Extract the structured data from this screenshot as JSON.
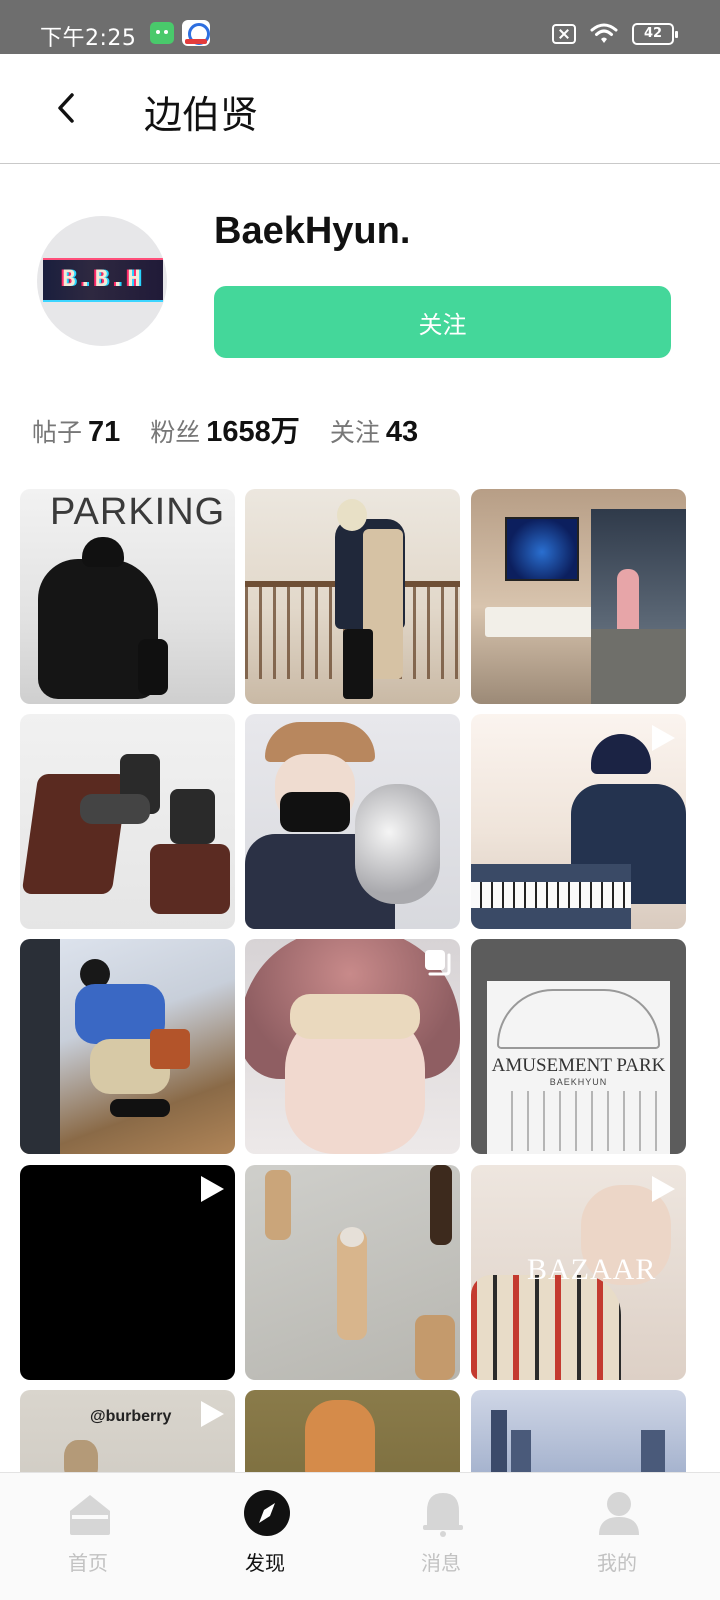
{
  "status_bar": {
    "time": "下午2:25",
    "battery": "42",
    "icons": [
      "android-notification-icon",
      "app-notification-icon",
      "no-sim-icon",
      "wifi-icon",
      "battery-icon"
    ]
  },
  "header": {
    "title": "边伯贤",
    "back_icon": "back-chevron-icon"
  },
  "profile": {
    "avatar_text": "B.B.H",
    "username": "BaekHyun.",
    "follow_label": "关注",
    "accent_color": "#44d79a"
  },
  "stats": [
    {
      "label": "帖子",
      "value": "71"
    },
    {
      "label": "粉丝",
      "value": "1658万"
    },
    {
      "label": "关注",
      "value": "43"
    }
  ],
  "grid": {
    "tiles": [
      {
        "overlay": "none",
        "caption": "PARKING"
      },
      {
        "overlay": "none",
        "caption": ""
      },
      {
        "overlay": "none",
        "caption": ""
      },
      {
        "overlay": "none",
        "caption": ""
      },
      {
        "overlay": "none",
        "caption": ""
      },
      {
        "overlay": "video",
        "caption": ""
      },
      {
        "overlay": "none",
        "caption": ""
      },
      {
        "overlay": "multi",
        "caption": ""
      },
      {
        "overlay": "none",
        "caption": "AMUSEMENT PARK",
        "subcaption": "BAEKHYUN"
      },
      {
        "overlay": "video",
        "caption": ""
      },
      {
        "overlay": "none",
        "caption": ""
      },
      {
        "overlay": "video",
        "caption": "BAZAAR"
      },
      {
        "overlay": "video",
        "caption": "@burberry"
      },
      {
        "overlay": "none",
        "caption": ""
      },
      {
        "overlay": "none",
        "caption": ""
      }
    ]
  },
  "bottom_nav": [
    {
      "label": "首页",
      "icon": "home-icon",
      "active": false
    },
    {
      "label": "发现",
      "icon": "compass-icon",
      "active": true
    },
    {
      "label": "消息",
      "icon": "bell-icon",
      "active": false
    },
    {
      "label": "我的",
      "icon": "person-icon",
      "active": false
    }
  ]
}
